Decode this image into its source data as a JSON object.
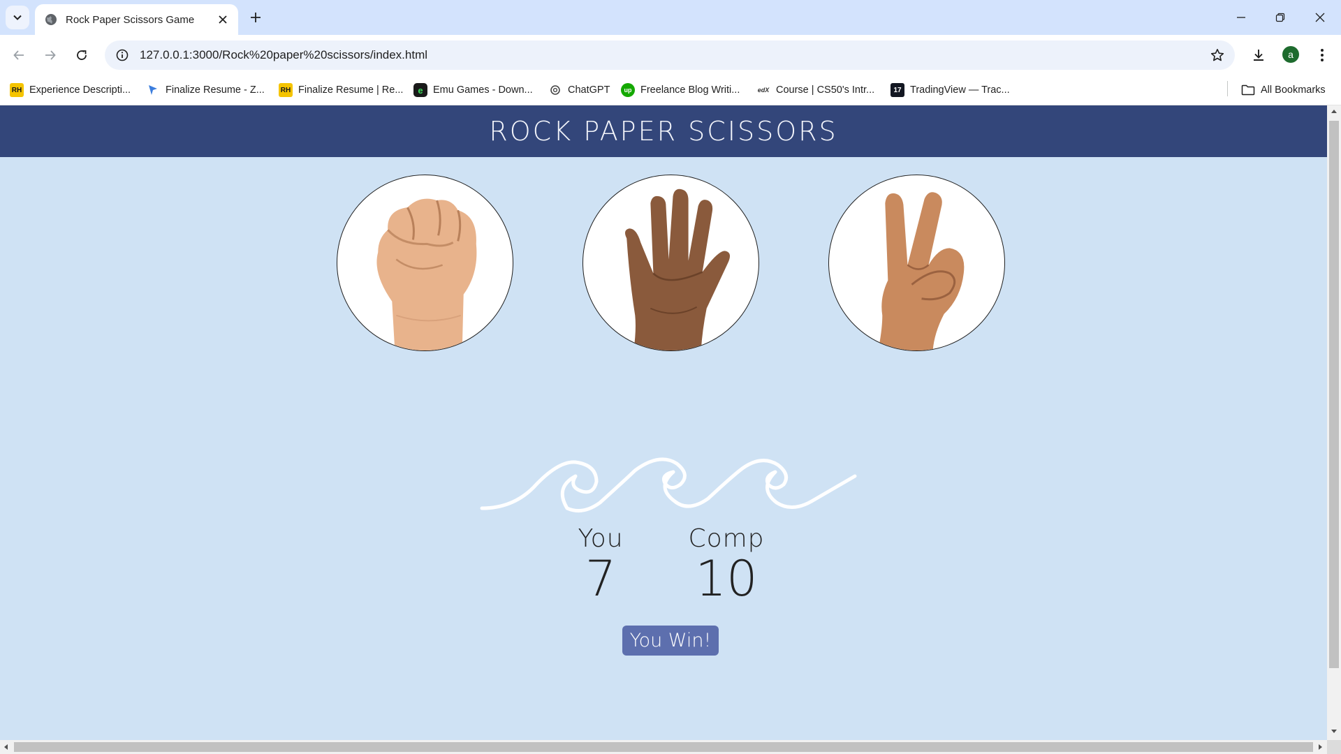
{
  "browser": {
    "tab_title": "Rock Paper Scissors Game",
    "url": "127.0.0.1:3000/Rock%20paper%20scissors/index.html",
    "profile_initial": "a",
    "bookmarks": [
      {
        "label": "Experience Descripti...",
        "icon": "rh-icon"
      },
      {
        "label": "Finalize Resume - Z...",
        "icon": "bookmark-arrow-icon"
      },
      {
        "label": "Finalize Resume | Re...",
        "icon": "rh-icon"
      },
      {
        "label": "Emu Games - Down...",
        "icon": "emu-icon"
      },
      {
        "label": "ChatGPT",
        "icon": "chatgpt-icon"
      },
      {
        "label": "Freelance Blog Writi...",
        "icon": "upwork-icon"
      },
      {
        "label": "Course | CS50's Intr...",
        "icon": "edx-icon"
      },
      {
        "label": "TradingView — Trac...",
        "icon": "tradingview-icon"
      }
    ],
    "all_bookmarks": "All Bookmarks"
  },
  "page": {
    "title": "ROCK PAPER SCISSORS",
    "choices": [
      {
        "name": "rock",
        "icon": "rock-fist-icon"
      },
      {
        "name": "paper",
        "icon": "paper-hand-icon"
      },
      {
        "name": "scissors",
        "icon": "scissors-hand-icon"
      }
    ],
    "score": {
      "you_label": "You",
      "you_value": "7",
      "comp_label": "Comp",
      "comp_value": "10"
    },
    "result": "You Win!"
  },
  "colors": {
    "header_bg": "#33467a",
    "page_bg": "#cfe2f4",
    "result_bg": "#5d6fae"
  }
}
